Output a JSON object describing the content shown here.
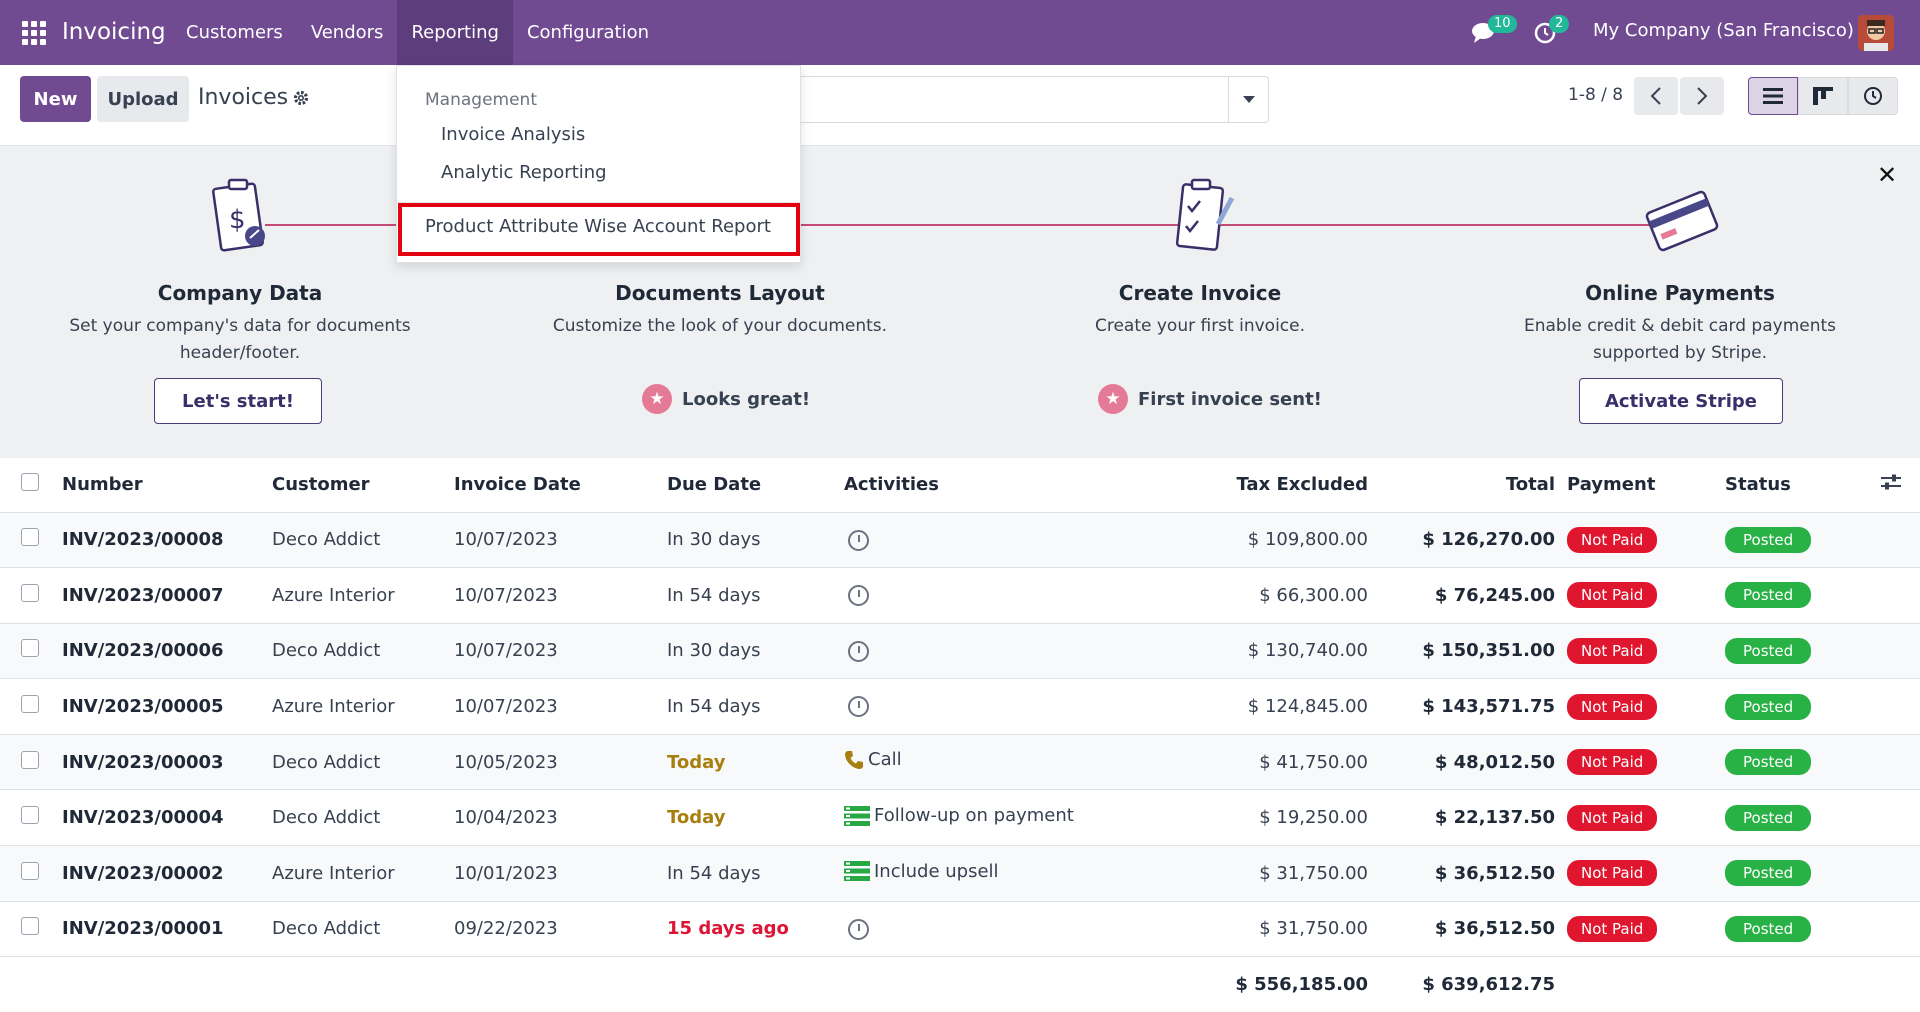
{
  "nav": {
    "brand": "Invoicing",
    "menu": [
      "Customers",
      "Vendors",
      "Reporting",
      "Configuration"
    ],
    "messages_badge": "10",
    "activities_badge": "2",
    "company": "My Company (San Francisco)"
  },
  "control": {
    "new_label": "New",
    "upload_label": "Upload",
    "title": "Invoices",
    "pager": "1-8 / 8"
  },
  "dropdown": {
    "header": "Management",
    "items": [
      "Invoice Analysis",
      "Analytic Reporting",
      "Product Attribute Wise Account Report"
    ]
  },
  "onboarding": {
    "steps": [
      {
        "title": "Company Data",
        "desc": "Set your company's data for documents header/footer.",
        "action": "Let's start!"
      },
      {
        "title": "Documents Layout",
        "desc": "Customize the look of your documents.",
        "done": "Looks great!"
      },
      {
        "title": "Create Invoice",
        "desc": "Create your first invoice.",
        "done": "First invoice sent!"
      },
      {
        "title": "Online Payments",
        "desc": "Enable credit & debit card payments supported by Stripe.",
        "action": "Activate Stripe"
      }
    ]
  },
  "table": {
    "columns": [
      "Number",
      "Customer",
      "Invoice Date",
      "Due Date",
      "Activities",
      "Tax Excluded",
      "Total",
      "Payment",
      "Status"
    ],
    "rows": [
      {
        "number": "INV/2023/00008",
        "customer": "Deco Addict",
        "date": "10/07/2023",
        "due": "In 30 days",
        "activity": "",
        "tax_excluded": "$ 109,800.00",
        "total": "$ 126,270.00",
        "payment": "Not Paid",
        "status": "Posted"
      },
      {
        "number": "INV/2023/00007",
        "customer": "Azure Interior",
        "date": "10/07/2023",
        "due": "In 54 days",
        "activity": "",
        "tax_excluded": "$ 66,300.00",
        "total": "$ 76,245.00",
        "payment": "Not Paid",
        "status": "Posted"
      },
      {
        "number": "INV/2023/00006",
        "customer": "Deco Addict",
        "date": "10/07/2023",
        "due": "In 30 days",
        "activity": "",
        "tax_excluded": "$ 130,740.00",
        "total": "$ 150,351.00",
        "payment": "Not Paid",
        "status": "Posted"
      },
      {
        "number": "INV/2023/00005",
        "customer": "Azure Interior",
        "date": "10/07/2023",
        "due": "In 54 days",
        "activity": "",
        "tax_excluded": "$ 124,845.00",
        "total": "$ 143,571.75",
        "payment": "Not Paid",
        "status": "Posted"
      },
      {
        "number": "INV/2023/00003",
        "customer": "Deco Addict",
        "date": "10/05/2023",
        "due": "Today",
        "activity": "Call",
        "tax_excluded": "$ 41,750.00",
        "total": "$ 48,012.50",
        "payment": "Not Paid",
        "status": "Posted"
      },
      {
        "number": "INV/2023/00004",
        "customer": "Deco Addict",
        "date": "10/04/2023",
        "due": "Today",
        "activity": "Follow-up on payment",
        "tax_excluded": "$ 19,250.00",
        "total": "$ 22,137.50",
        "payment": "Not Paid",
        "status": "Posted"
      },
      {
        "number": "INV/2023/00002",
        "customer": "Azure Interior",
        "date": "10/01/2023",
        "due": "In 54 days",
        "activity": "Include upsell",
        "tax_excluded": "$ 31,750.00",
        "total": "$ 36,512.50",
        "payment": "Not Paid",
        "status": "Posted"
      },
      {
        "number": "INV/2023/00001",
        "customer": "Deco Addict",
        "date": "09/22/2023",
        "due": "15 days ago",
        "activity": "",
        "tax_excluded": "$ 31,750.00",
        "total": "$ 36,512.50",
        "payment": "Not Paid",
        "status": "Posted"
      }
    ],
    "totals": {
      "tax_excluded": "$ 556,185.00",
      "total": "$ 639,612.75"
    }
  }
}
